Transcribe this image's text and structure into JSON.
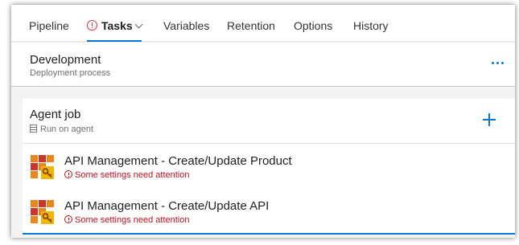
{
  "tabs": [
    {
      "label": "Pipeline",
      "active": false
    },
    {
      "label": "Tasks",
      "active": true,
      "warning_icon": "warning-circle-icon",
      "dropdown_icon": "chevron-down-icon"
    },
    {
      "label": "Variables",
      "active": false
    },
    {
      "label": "Retention",
      "active": false
    },
    {
      "label": "Options",
      "active": false
    },
    {
      "label": "History",
      "active": false
    }
  ],
  "stage": {
    "name": "Development",
    "subtitle": "Deployment process",
    "more_icon": "more-ellipsis-icon"
  },
  "agent_job": {
    "title": "Agent job",
    "subtitle": "Run on agent",
    "subtitle_icon": "server-icon",
    "add_icon": "add-plus-icon"
  },
  "tasks": [
    {
      "name": "API Management - Create/Update Product",
      "warning": "Some settings need attention",
      "icon": "api-management-icon"
    },
    {
      "name": "API Management - Create/Update API",
      "warning": "Some settings need attention",
      "icon": "api-management-icon"
    }
  ],
  "colors": {
    "accent": "#0078d4",
    "warning": "#c50f1f",
    "icon_orange": "#e8871e",
    "icon_red": "#c7372f",
    "icon_yellow": "#f2b600"
  }
}
